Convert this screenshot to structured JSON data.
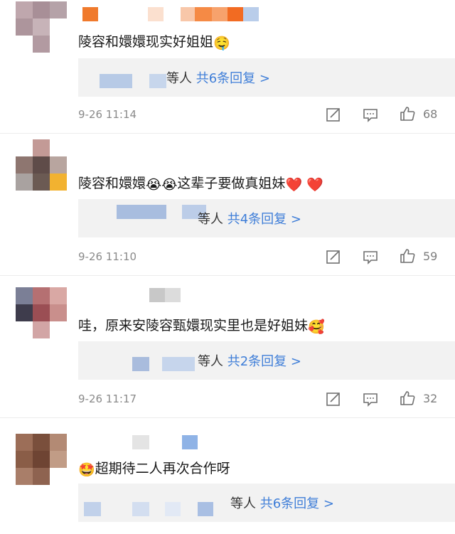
{
  "colors": {
    "link": "#3f7ed8",
    "meta": "#8a8a8a",
    "reply_bg": "#f2f2f2"
  },
  "comments": [
    {
      "text": "陵容和嬛嬛现实好姐姐",
      "emoji": "🤤",
      "reply_prefix": "等人",
      "reply_link": "共6条回复 >",
      "timestamp": "9-26 11:14",
      "likes": "68"
    },
    {
      "text": "陵容和嬛嬛",
      "emoji_mid": "😭😭",
      "text2": "这辈子要做真姐妹",
      "emoji": "❤️ ❤️",
      "reply_prefix": "等人",
      "reply_link": "共4条回复 >",
      "timestamp": "9-26 11:10",
      "likes": "59"
    },
    {
      "text": "哇，原来安陵容甄嬛现实里也是好姐妹",
      "emoji": "🥰",
      "reply_prefix": "等人",
      "reply_link": "共2条回复 >",
      "timestamp": "9-26 11:17",
      "likes": "32"
    },
    {
      "emoji_lead": "🤩",
      "text": "超期待二人再次合作呀",
      "reply_prefix": "等人",
      "reply_link": "共6条回复 >"
    }
  ]
}
